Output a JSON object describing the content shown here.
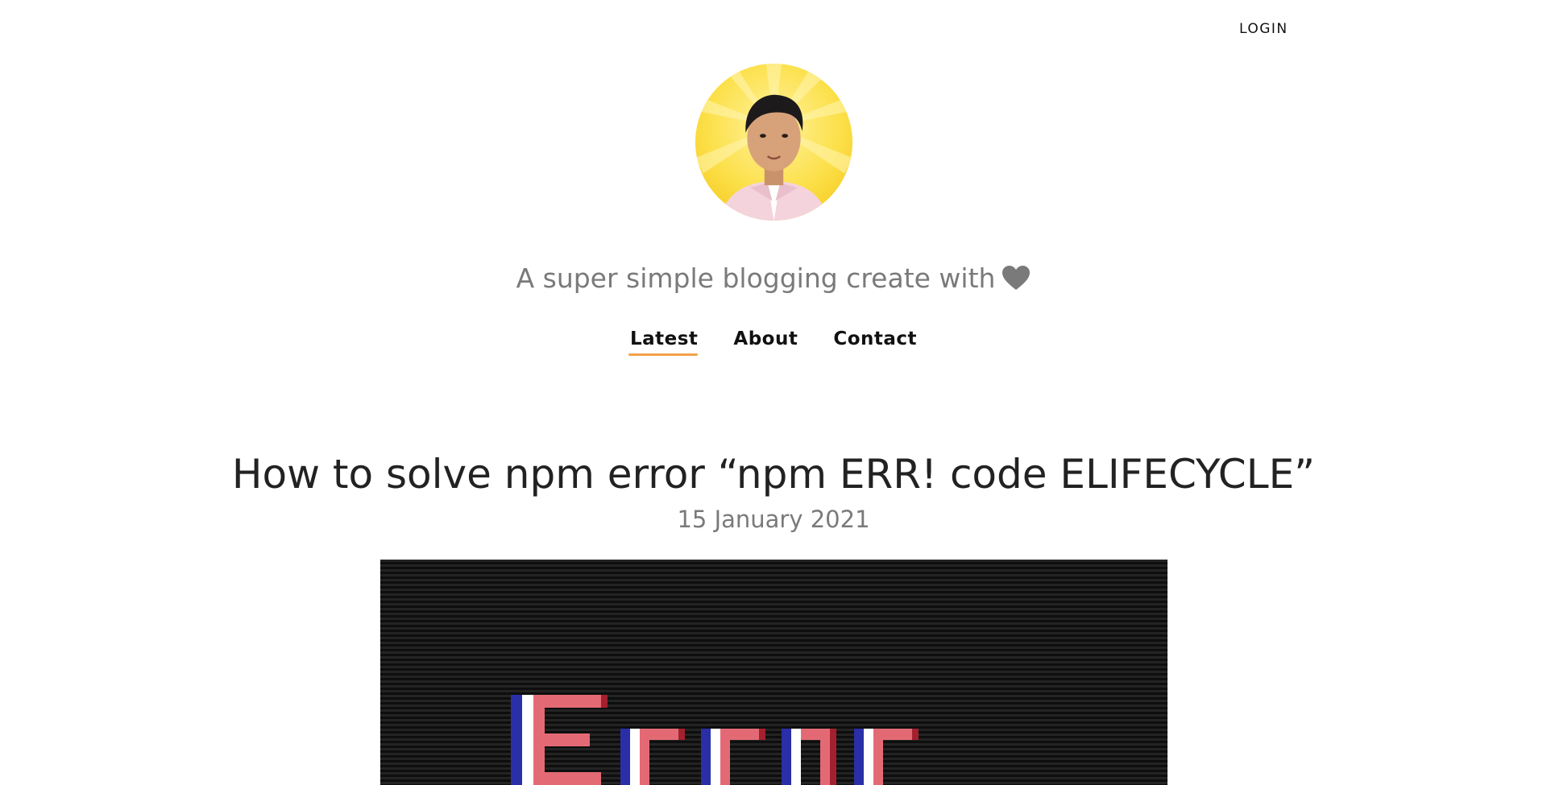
{
  "header": {
    "login_label": "LOGIN",
    "tagline": "A super simple blogging create with"
  },
  "nav": {
    "items": [
      {
        "label": "Latest",
        "active": true
      },
      {
        "label": "About",
        "active": false
      },
      {
        "label": "Contact",
        "active": false
      }
    ]
  },
  "post": {
    "title": "How to solve npm error “npm ERR! code ELIFECYCLE”",
    "date": "15 January 2021",
    "cover_text": "Error"
  },
  "colors": {
    "accent": "#f3a24b",
    "muted_text": "#7a7a7a",
    "avatar_bg": "#fbd93a"
  },
  "icons": {
    "heart": "heart-icon"
  }
}
